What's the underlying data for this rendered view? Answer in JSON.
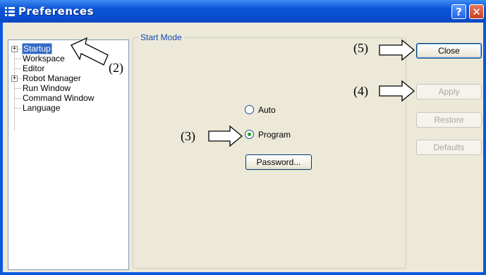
{
  "window": {
    "title": "Preferences",
    "help_label": "?",
    "close_label": "✕"
  },
  "tree": {
    "items": [
      {
        "label": "Startup",
        "expandable": true,
        "selected": true
      },
      {
        "label": "Workspace"
      },
      {
        "label": "Editor"
      },
      {
        "label": "Robot Manager",
        "expandable": true
      },
      {
        "label": "Run Window"
      },
      {
        "label": "Command Window"
      },
      {
        "label": "Language"
      }
    ]
  },
  "start_mode": {
    "group_label": "Start Mode",
    "options": [
      {
        "label": "Auto",
        "selected": false
      },
      {
        "label": "Program",
        "selected": true
      }
    ],
    "password_label": "Password..."
  },
  "buttons": {
    "close": "Close",
    "apply": "Apply",
    "restore": "Restore",
    "defaults": "Defaults"
  },
  "callouts": {
    "c2": "(2)",
    "c3": "(3)",
    "c4": "(4)",
    "c5": "(5)"
  },
  "colors": {
    "titlebar": "#0a53d6",
    "client": "#ece9d8",
    "selection": "#316ac5",
    "group_label": "#1346b4"
  }
}
